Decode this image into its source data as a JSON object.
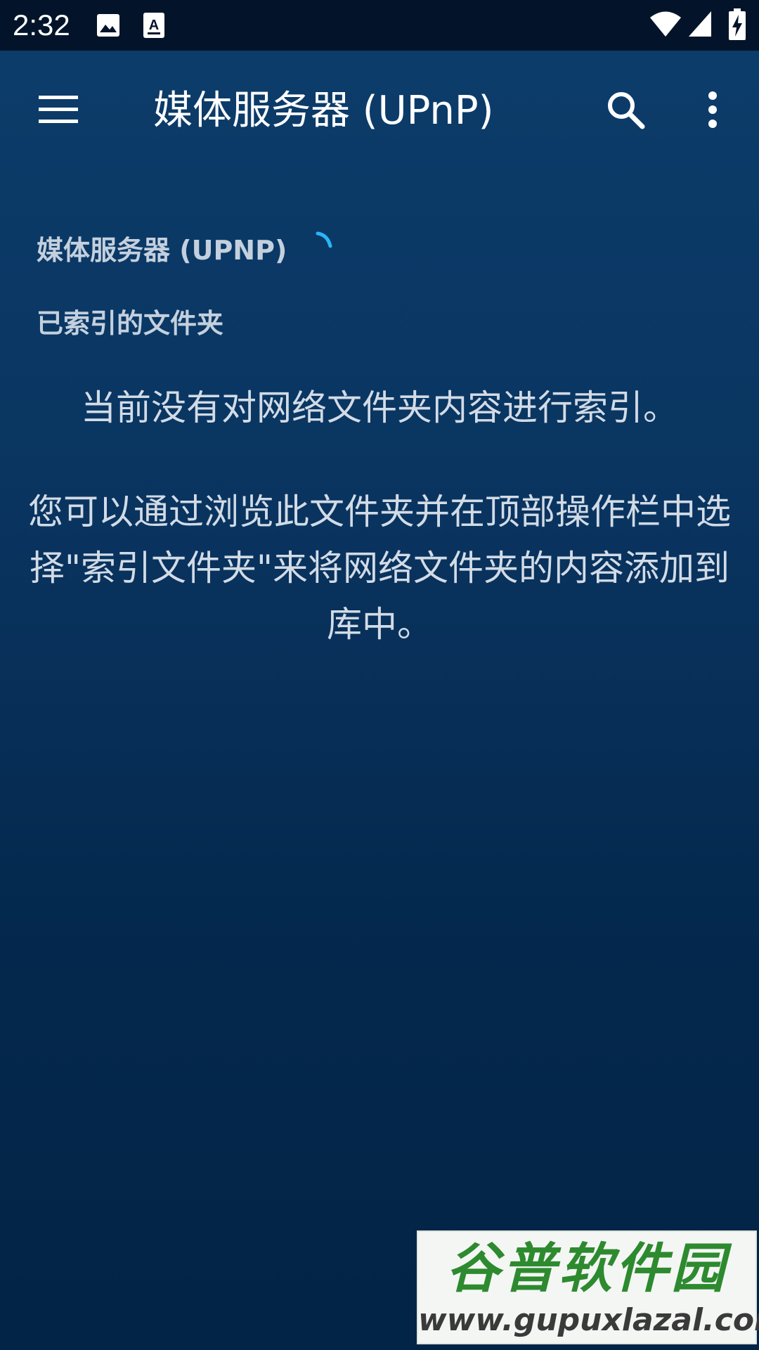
{
  "status_bar": {
    "time": "2:32",
    "icons": [
      "image-notification-icon",
      "text-notification-icon",
      "wifi-icon",
      "cell-signal-icon",
      "battery-charging-icon"
    ]
  },
  "app_bar": {
    "title": "媒体服务器 (UPnP)",
    "menu_icon": "hamburger-menu-icon",
    "search_icon": "search-icon",
    "overflow_icon": "more-vert-icon"
  },
  "content": {
    "section_title": "媒体服务器 (UPNP)",
    "subsection_title": "已索引的文件夹",
    "empty_message": "当前没有对网络文件夹内容进行索引。",
    "help_text": "您可以通过浏览此文件夹并在顶部操作栏中选择\"索引文件夹\"来将网络文件夹的内容添加到库中。"
  },
  "watermark": {
    "logo_text": "谷普软件园",
    "url": "www.gupuxlazal.com"
  },
  "colors": {
    "accent": "#29b6f6",
    "status_bar_bg": "#03142a",
    "watermark_green": "#2d8a2f"
  }
}
